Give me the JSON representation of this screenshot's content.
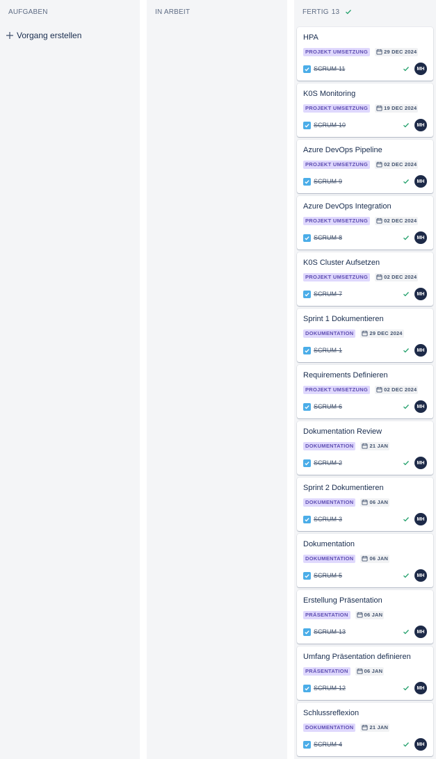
{
  "colors": {
    "column_bg": "#f4f5f7",
    "label_bg": "#dfd8fd",
    "label_text": "#5e4db2",
    "done_green": "#22a06b",
    "task_blue": "#4bade8",
    "avatar_bg": "#1d2a48"
  },
  "columns": {
    "aufgaben": {
      "title": "AUFGABEN",
      "create_label": "Vorgang erstellen",
      "create_icon": "plus-icon"
    },
    "in_arbeit": {
      "title": "IN ARBEIT"
    },
    "fertig": {
      "title": "FERTIG",
      "count": "13",
      "status_icon": "check-icon"
    }
  },
  "cards": [
    {
      "title": "HPA",
      "label": "PROJEKT UMSETZUNG",
      "due": "29 DEC 2024",
      "key": "SCRUM-11",
      "assignee": "MH"
    },
    {
      "title": "K0S Monitoring",
      "label": "PROJEKT UMSETZUNG",
      "due": "19 DEC 2024",
      "key": "SCRUM-10",
      "assignee": "MH"
    },
    {
      "title": "Azure DevOps Pipeline",
      "label": "PROJEKT UMSETZUNG",
      "due": "02 DEC 2024",
      "key": "SCRUM-9",
      "assignee": "MH"
    },
    {
      "title": "Azure DevOps Integration",
      "label": "PROJEKT UMSETZUNG",
      "due": "02 DEC 2024",
      "key": "SCRUM-8",
      "assignee": "MH"
    },
    {
      "title": "K0S Cluster Aufsetzen",
      "label": "PROJEKT UMSETZUNG",
      "due": "02 DEC 2024",
      "key": "SCRUM-7",
      "assignee": "MH"
    },
    {
      "title": "Sprint 1 Dokumentieren",
      "label": "DOKUMENTATION",
      "due": "29 DEC 2024",
      "key": "SCRUM-1",
      "assignee": "MH"
    },
    {
      "title": "Requirements Definieren",
      "label": "PROJEKT UMSETZUNG",
      "due": "02 DEC 2024",
      "key": "SCRUM-6",
      "assignee": "MH"
    },
    {
      "title": "Dokumentation Review",
      "label": "DOKUMENTATION",
      "due": "21 JAN",
      "key": "SCRUM-2",
      "assignee": "MH"
    },
    {
      "title": "Sprint 2 Dokumentieren",
      "label": "DOKUMENTATION",
      "due": "06 JAN",
      "key": "SCRUM-3",
      "assignee": "MH"
    },
    {
      "title": "Dokumentation",
      "label": "DOKUMENTATION",
      "due": "06 JAN",
      "key": "SCRUM-5",
      "assignee": "MH"
    },
    {
      "title": "Erstellung Präsentation",
      "label": "PRÄSENTATION",
      "due": "06 JAN",
      "key": "SCRUM-13",
      "assignee": "MH"
    },
    {
      "title": "Umfang Präsentation definieren",
      "label": "PRÄSENTATION",
      "due": "06 JAN",
      "key": "SCRUM-12",
      "assignee": "MH"
    },
    {
      "title": "Schlussreflexion",
      "label": "DOKUMENTATION",
      "due": "21 JAN",
      "key": "SCRUM-4",
      "assignee": "MH"
    }
  ]
}
